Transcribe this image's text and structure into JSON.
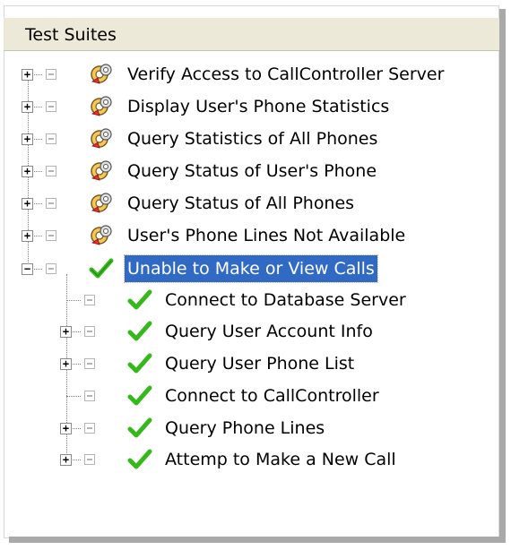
{
  "header": {
    "label": "Test Suites"
  },
  "colors": {
    "selection": "#316ac5",
    "check": "#35b81a",
    "tree_lines": "#808080",
    "header_bg": "#ece9d8"
  },
  "suites": [
    {
      "label": "Verify Access to CallController Server",
      "icon": "suite-gear-icon",
      "state": "collapsed"
    },
    {
      "label": "Display User's Phone Statistics",
      "icon": "suite-gear-icon",
      "state": "collapsed"
    },
    {
      "label": "Query Statistics of All Phones",
      "icon": "suite-gear-icon",
      "state": "collapsed"
    },
    {
      "label": "Query Status of User's Phone",
      "icon": "suite-gear-icon",
      "state": "collapsed"
    },
    {
      "label": "Query Status of All Phones",
      "icon": "suite-gear-icon",
      "state": "collapsed"
    },
    {
      "label": "User's Phone Lines Not Available",
      "icon": "suite-gear-icon",
      "state": "collapsed"
    },
    {
      "label": "Unable to Make or View Calls",
      "icon": "checkmark-icon",
      "state": "expanded",
      "selected": true,
      "children": [
        {
          "label": "Connect to Database Server",
          "icon": "checkmark-icon",
          "state": "leaf"
        },
        {
          "label": "Query User Account Info",
          "icon": "checkmark-icon",
          "state": "collapsed"
        },
        {
          "label": "Query User Phone List",
          "icon": "checkmark-icon",
          "state": "collapsed"
        },
        {
          "label": "Connect to CallController",
          "icon": "checkmark-icon",
          "state": "leaf"
        },
        {
          "label": "Query Phone Lines",
          "icon": "checkmark-icon",
          "state": "collapsed"
        },
        {
          "label": "Attemp to Make a New Call",
          "icon": "checkmark-icon",
          "state": "collapsed"
        }
      ]
    }
  ]
}
